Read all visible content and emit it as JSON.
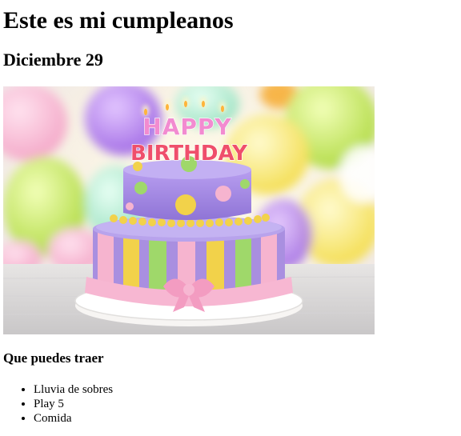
{
  "page": {
    "title": "Este es mi cumpleanos",
    "date": "Diciembre 29",
    "image": {
      "icon": "birthday-cake-photo",
      "topper_line1": "HAPPY",
      "topper_line2": "BIRTHDAY",
      "colors": {
        "purple": "#a98fe0",
        "pink": "#f6b4cf",
        "yellow": "#f2d24a",
        "green": "#9fd86a",
        "orange": "#f4a940"
      }
    },
    "list_heading": "Que puedes traer",
    "items": [
      "Lluvia de sobres",
      "Play 5",
      "Comida"
    ]
  }
}
